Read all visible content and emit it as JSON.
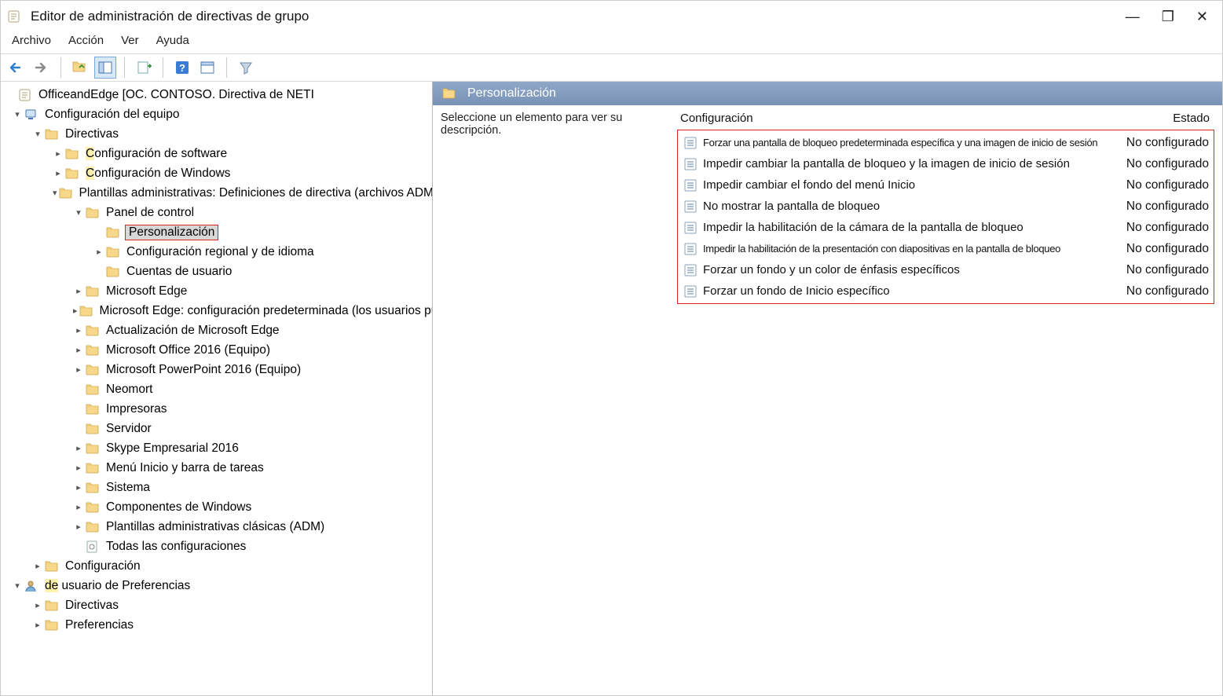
{
  "window": {
    "title": "Editor de administración de directivas de grupo"
  },
  "menu": {
    "file": "Archivo",
    "action": "Acción",
    "view": "Ver",
    "help": "Ayuda"
  },
  "tree": {
    "root": "OfficeandEdge [OC. CONTOSO. Directiva de NETI",
    "computerConfig": "Configuración del equipo",
    "directivas": "Directivas",
    "confSoftware_hl": "C",
    "confSoftware_rest": "onfiguración de software",
    "confWindows_hl": "C",
    "confWindows_rest": "onfiguración de Windows",
    "adminTemplates": "Plantillas administrativas: Definiciones de directiva (archivos ADMX)",
    "controlPanel": "Panel de control",
    "personalizacion": "Personalización",
    "regionalLang": "Configuración regional y de idioma",
    "userAccounts": "Cuentas de usuario",
    "edge": "Microsoft Edge",
    "edgeDefault": "Microsoft Edge: configuración predeterminada (los usuarios pueden invalidar)",
    "edgeUpdate": "Actualización de Microsoft Edge",
    "office2016": "Microsoft Office 2016 (Equipo)",
    "ppt2016": "Microsoft PowerPoint 2016 (Equipo)",
    "neomort": "Neomort",
    "printers": "Impresoras",
    "server": "Servidor",
    "skype": "Skype Empresarial 2016",
    "startMenu": "Menú Inicio y barra de tareas",
    "system": "Sistema",
    "winComponents": "Componentes de Windows",
    "classicAdm": "Plantillas administrativas clásicas (ADM)",
    "allSettings": "Todas las configuraciones",
    "configuracion": "Configuración",
    "userPrefs_hl": "de",
    "userPrefs_rest": " usuario de Preferencias",
    "directivas2": "Directivas",
    "preferencias": "Preferencias"
  },
  "detail": {
    "header": "Personalización",
    "instruction": "Seleccione un elemento para ver su descripción.",
    "colConfig": "Configuración",
    "colState": "Estado",
    "stateNotConfigured": "No configurado",
    "settings": [
      "Forzar una pantalla de bloqueo predeterminada específica y una imagen de inicio de sesión",
      "Impedir cambiar la pantalla de bloqueo y la imagen de inicio de sesión",
      "Impedir cambiar el fondo del menú Inicio",
      "No mostrar la pantalla de bloqueo",
      "Impedir la habilitación de la cámara de la pantalla de bloqueo",
      "Impedir la habilitación de la presentación con diapositivas en la pantalla de bloqueo",
      "Forzar un fondo y un color de énfasis específicos",
      "Forzar un fondo de Inicio específico"
    ]
  }
}
